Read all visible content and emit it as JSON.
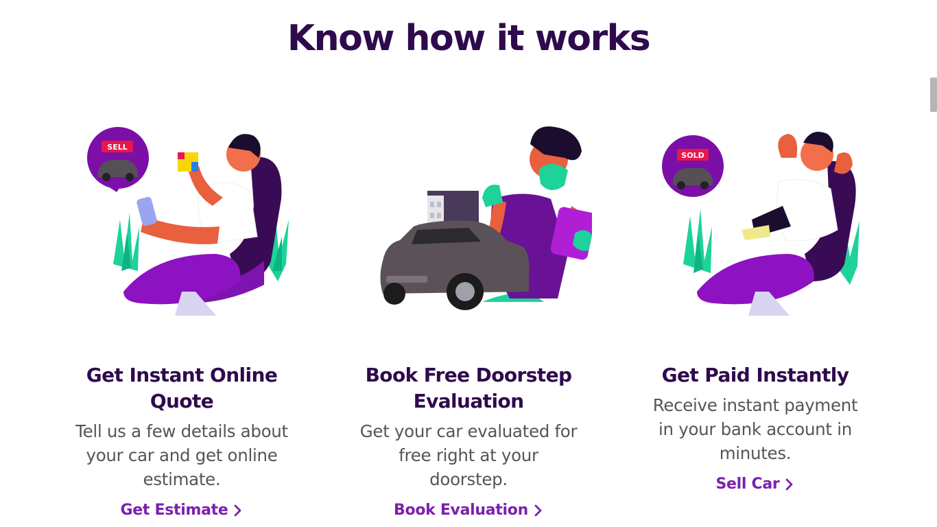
{
  "heading": {
    "title": "Know how it works"
  },
  "steps": [
    {
      "title": "Get Instant Online Quote",
      "description": "Tell us a few details about your car and get online estimate.",
      "link_label": "Get Estimate",
      "badge_text": "SELL",
      "illustration": "man-with-phone-selling-car-illustration"
    },
    {
      "title": "Book Free Doorstep Evaluation",
      "description": "Get your car evaluated for free right at your doorstep.",
      "link_label": "Book Evaluation",
      "illustration": "inspector-with-car-illustration"
    },
    {
      "title": "Get Paid Instantly",
      "description": "Receive instant payment in your bank account in minutes.",
      "link_label": "Sell Car",
      "badge_text": "SOLD",
      "illustration": "relaxed-man-paid-illustration"
    }
  ],
  "colors": {
    "title": "#2f0a4d",
    "link": "#7c1fad",
    "badge_purple": "#7b0fa8",
    "badge_red": "#e8174a",
    "plant_green": "#1dd39a"
  }
}
